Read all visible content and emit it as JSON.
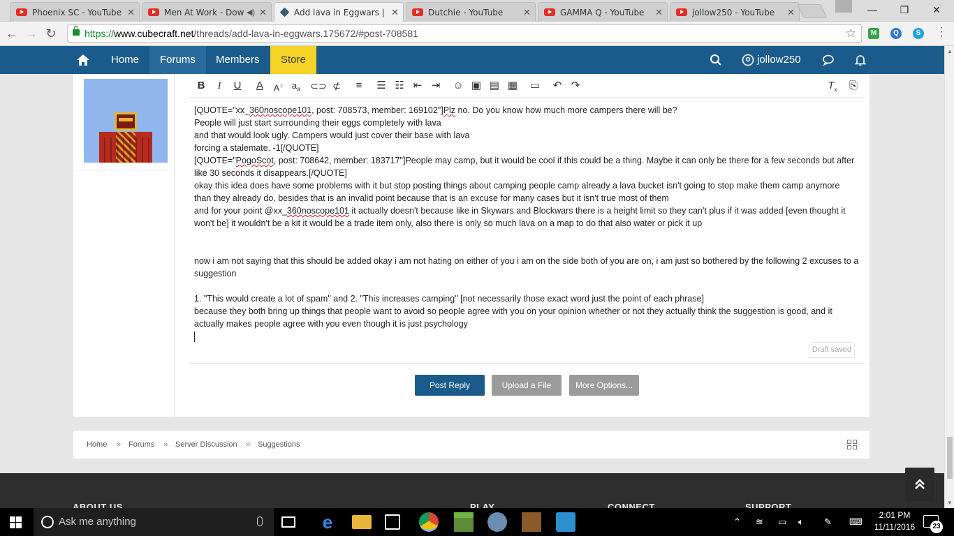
{
  "browser": {
    "tabs": [
      {
        "title": "Phoenix SC - YouTube",
        "icon": "youtube-icon",
        "active": false
      },
      {
        "title": "Men At Work - Down",
        "icon": "youtube-icon",
        "active": false,
        "audio": true
      },
      {
        "title": "Add lava in Eggwars | C",
        "icon": "cubecraft-icon",
        "active": true
      },
      {
        "title": "Dutchie - YouTube",
        "icon": "youtube-icon",
        "active": false
      },
      {
        "title": "GAMMA Q - YouTube",
        "icon": "youtube-icon",
        "active": false
      },
      {
        "title": "jollow250 - YouTube",
        "icon": "youtube-icon",
        "active": false
      }
    ],
    "url": {
      "protocol": "https://",
      "host": "www.cubecraft.net",
      "path": "/threads/add-lava-in-eggwars.175672/#post-708581"
    }
  },
  "site_nav": {
    "items": [
      "Home",
      "Forums",
      "Members",
      "Store"
    ],
    "active": "Forums",
    "username": "jollow250"
  },
  "editor": {
    "draft_status": "Draft saved",
    "paragraphs": [
      {
        "segments": [
          {
            "text": "[QUOTE=\"xx_"
          },
          {
            "text": "360noscope101",
            "squiggle": true
          },
          {
            "text": ", post: 708573, member: 169102\"]"
          },
          {
            "text": "Plz",
            "squiggle": true
          },
          {
            "text": " no. Do you know how much more campers there will be?"
          }
        ]
      },
      {
        "segments": [
          {
            "text": "People will just start surrounding their eggs completely with lava"
          }
        ]
      },
      {
        "segments": [
          {
            "text": "and that would look ugly. Campers would just cover their base with lava"
          }
        ]
      },
      {
        "segments": [
          {
            "text": "forcing a stalemate. -1[/QUOTE]"
          }
        ]
      },
      {
        "segments": [
          {
            "text": "[QUOTE=\""
          },
          {
            "text": "PogoScot",
            "squiggle": true
          },
          {
            "text": ", post: 708642, member: 183717\"]People may camp, but it would be cool if this could be a thing. Maybe it can only be there for a few seconds but after like 30 seconds it disappears.[/QUOTE]"
          }
        ]
      },
      {
        "segments": [
          {
            "text": "okay this idea does have some problems with it but stop posting things about camping people camp already a lava bucket isn't going to stop make them camp anymore than they already do, besides that is an invalid point because that is an excuse for many cases but it isn't true most of them"
          }
        ]
      },
      {
        "segments": [
          {
            "text": "and for your point @xx_"
          },
          {
            "text": "360noscope101",
            "squiggle": true
          },
          {
            "text": " it actually doesn't because like in Skywars and Blockwars there is a height limit so they can't plus if it was added [even thought it won't be] it wouldn't be a kit it would be a trade item only, also there is only so much lava on a map to do that also water or pick it up"
          }
        ]
      },
      {
        "segments": []
      },
      {
        "segments": []
      },
      {
        "segments": [
          {
            "text": "now i am not saying that this should be added okay i am not hating on either of you i am on the side both of you are on, i am just so bothered by the following 2 excuses to a suggestion"
          }
        ]
      },
      {
        "segments": []
      },
      {
        "segments": [
          {
            "text": "1. \"This would create a lot of spam\" and 2. \"This increases camping\" [not necessarily those exact word just the point of each phrase]"
          }
        ]
      },
      {
        "segments": [
          {
            "text": "because they both bring up things that people want to avoid so people agree with you on your opinion whether or not they actually think the suggestion is good, and it actually makes people agree with you even though it is just psychology"
          }
        ]
      }
    ]
  },
  "buttons": {
    "post_reply": "Post Reply",
    "upload": "Upload a File",
    "more_options": "More Options..."
  },
  "breadcrumb": [
    "Home",
    "Forums",
    "Server Discussion",
    "Suggestions"
  ],
  "footer": {
    "headings": [
      "ABOUT US",
      "PLAY",
      "CONNECT",
      "SUPPORT"
    ]
  },
  "taskbar": {
    "search_placeholder": "Ask me anything",
    "time": "2:01 PM",
    "date": "11/11/2016",
    "notification_count": "23"
  },
  "colors": {
    "nav_bg": "#1b5b8c",
    "store_bg": "#f5d327",
    "primary_button": "#1b5b8c",
    "secondary_button": "#9b9b9b"
  }
}
